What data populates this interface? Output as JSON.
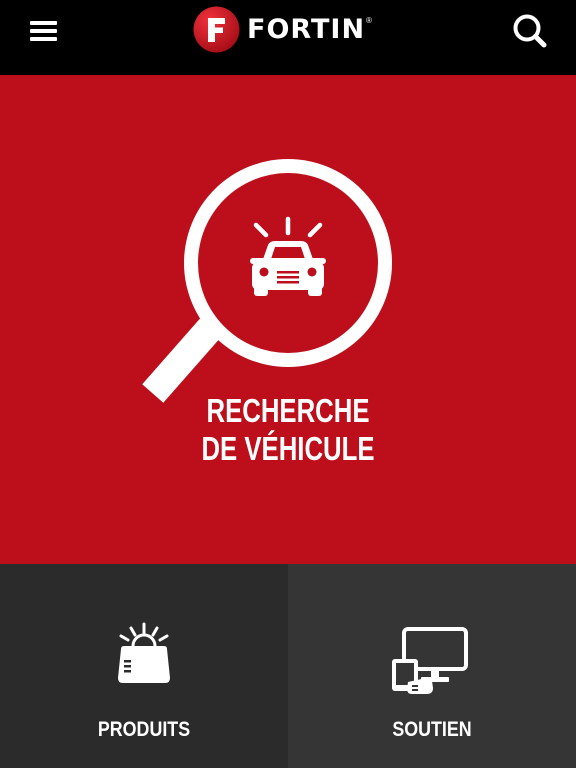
{
  "header": {
    "brand_name": "FORTIN",
    "brand_mark": "®",
    "logo_letter": "F",
    "menu_icon": "hamburger-menu-icon",
    "search_icon": "search-icon"
  },
  "hero": {
    "title_line1": "RECHERCHE",
    "title_line2": "DE VÉHICULE",
    "icon": "magnifier-car-icon",
    "background_color": "#bd0f1b"
  },
  "tiles": [
    {
      "label": "PRODUITS",
      "icon": "remote-starter-icon"
    },
    {
      "label": "SOUTIEN",
      "icon": "support-devices-icon"
    }
  ],
  "colors": {
    "brand_red": "#bd0f1b",
    "header_bg": "#000000",
    "tile_dark": "#2b2b2b",
    "tile_mid": "#353535"
  }
}
